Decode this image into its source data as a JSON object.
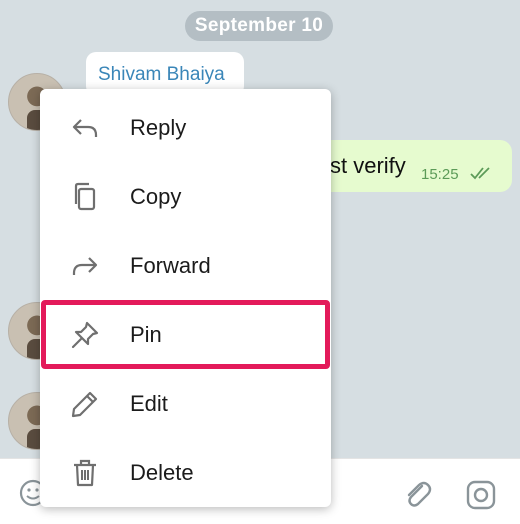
{
  "chat": {
    "date_label": "September 10",
    "sender_name": "Shivam Bhaiya",
    "outgoing_text": "st verify",
    "outgoing_time": "15:25"
  },
  "menu": {
    "items": [
      {
        "label": "Reply",
        "icon": "reply-icon"
      },
      {
        "label": "Copy",
        "icon": "copy-icon"
      },
      {
        "label": "Forward",
        "icon": "forward-icon"
      },
      {
        "label": "Pin",
        "icon": "pin-icon"
      },
      {
        "label": "Edit",
        "icon": "pencil-icon"
      },
      {
        "label": "Delete",
        "icon": "trash-icon"
      }
    ],
    "highlighted": "Pin",
    "highlight_color": "#e31a5a"
  },
  "input_bar": {
    "icons": [
      "emoji-icon",
      "paperclip-icon",
      "camera-icon"
    ]
  },
  "colors": {
    "chat_background": "#d6dee2",
    "outgoing_bubble": "#e6fbcf",
    "sender_name": "#3a86b8"
  }
}
